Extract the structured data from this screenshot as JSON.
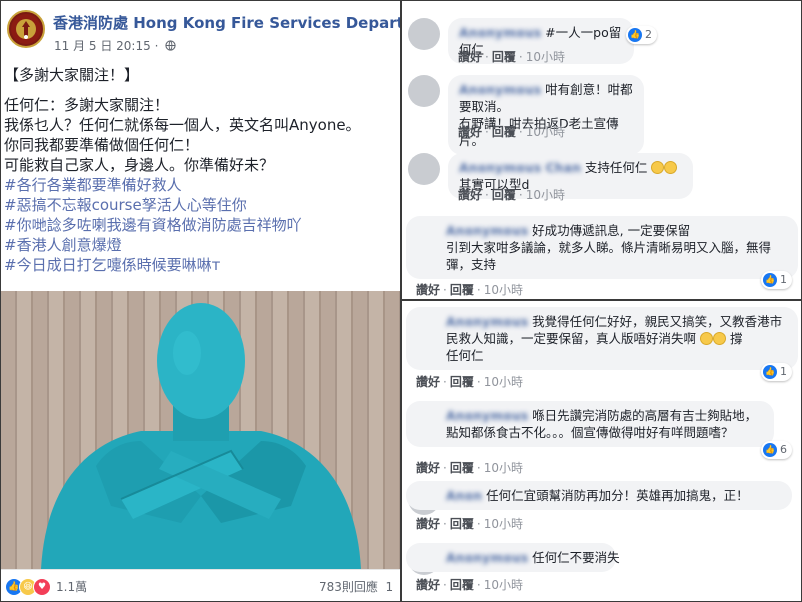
{
  "post": {
    "page_name": "香港消防處 Hong Kong Fire Services Department",
    "date": "11 月 5 日 20:15",
    "dot": "·",
    "globe_icon": "globe-icon",
    "lines": [
      "【多謝大家關注！】",
      "任何仁：多謝大家關注！",
      "我係乜人？任何仁就係每一個人，英文名叫Anyone。",
      "你同我都要準備做個任何仁！",
      "可能救自己家人，身邊人。你準備好未？"
    ],
    "hashtags": [
      "#各行各業都要準備好救人",
      "#惡搞不忘報course孥活人心等住你",
      "#你哋諗多咗喇我邊有資格做消防處吉祥物吖",
      "#香港人創意爆燈",
      "#今日成日打乞嚏係時候要啉啉т"
    ],
    "reaction_count": "1.1萬",
    "comment_count": "783則回應",
    "share_glimpse": "1",
    "reaction_icons": [
      "like-icon",
      "haha-icon",
      "love-icon"
    ]
  },
  "action_labels": {
    "like": "讚好",
    "reply": "回覆",
    "sep": "·"
  },
  "comments_top": [
    {
      "text": "#一人一po留何仁",
      "time": "10小時",
      "likes": "2"
    },
    {
      "text": "咁有創意！咁都要取消。\n冇野講！咁去拍返D老土宣傳片。",
      "time": "10小時",
      "likes": ""
    },
    {
      "text": "支持任何仁",
      "text_after": "其實可以型d",
      "time": "10小時",
      "likes": ""
    },
    {
      "text": "好成功傳遞訊息, 一定要保留\n引到大家咁多議論，就多人睇。條片清晰易明又入腦，無得彈，支持",
      "time": "10小時",
      "likes": "1"
    }
  ],
  "comments_bottom": [
    {
      "text": "我覺得任何仁好好，親民又搞笑，又教香港市民救人知識，一定要保留，真人版唔好消失啊",
      "text_after": "撐\n任何仁",
      "time": "10小時",
      "likes": "1"
    },
    {
      "text": "喺日先讚完消防處的高層有吉士夠貼地，點知都係食古不化。。。個宣傳做得咁好有咩問題嗜？",
      "time": "10小時",
      "likes": "6"
    },
    {
      "text": "任何仁宜頭幫消防再加分！英雄再加搞鬼，正！",
      "time": "10小時",
      "likes": ""
    },
    {
      "text": "任何仁不要消失",
      "time": "10小時",
      "likes": ""
    }
  ],
  "colors": {
    "link_blue": "#365899",
    "hashtag": "#5a6fae",
    "bubble": "#f2f3f5",
    "like_blue": "#1877f2",
    "suit": "#27b3c4"
  }
}
